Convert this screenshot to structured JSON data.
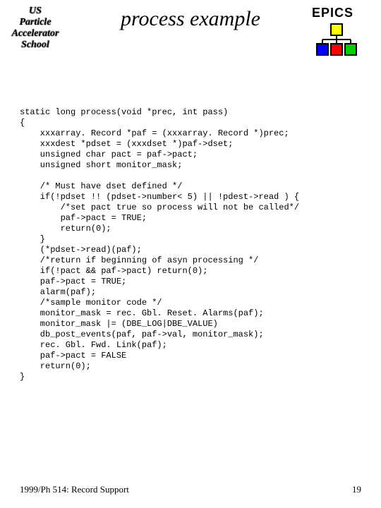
{
  "header": {
    "logo_left": {
      "line1": "US",
      "line2": "Particle",
      "line3": "Accelerator",
      "line4": "School"
    },
    "title": "process example",
    "epics_label": "EPICS"
  },
  "code": "static long process(void *prec, int pass)\n{\n    xxxarray. Record *paf = (xxxarray. Record *)prec;\n    xxxdest *pdset = (xxxdset *)paf->dset;\n    unsigned char pact = paf->pact;\n    unsigned short monitor_mask;\n\n    /* Must have dset defined */\n    if(!pdset !! (pdset->number< 5) || !pdest->read ) {\n        /*set pact true so process will not be called*/\n        paf->pact = TRUE;\n        return(0);\n    }\n    (*pdset->read)(paf);\n    /*return if beginning of asyn processing */\n    if(!pact && paf->pact) return(0);\n    paf->pact = TRUE;\n    alarm(paf);\n    /*sample monitor code */\n    monitor_mask = rec. Gbl. Reset. Alarms(paf);\n    monitor_mask |= (DBE_LOG|DBE_VALUE)\n    db_post_events(paf, paf->val, monitor_mask);\n    rec. Gbl. Fwd. Link(paf);\n    paf->pact = FALSE\n    return(0);\n}",
  "footer": {
    "left": "1999/Ph 514: Record Support",
    "page": "19"
  }
}
